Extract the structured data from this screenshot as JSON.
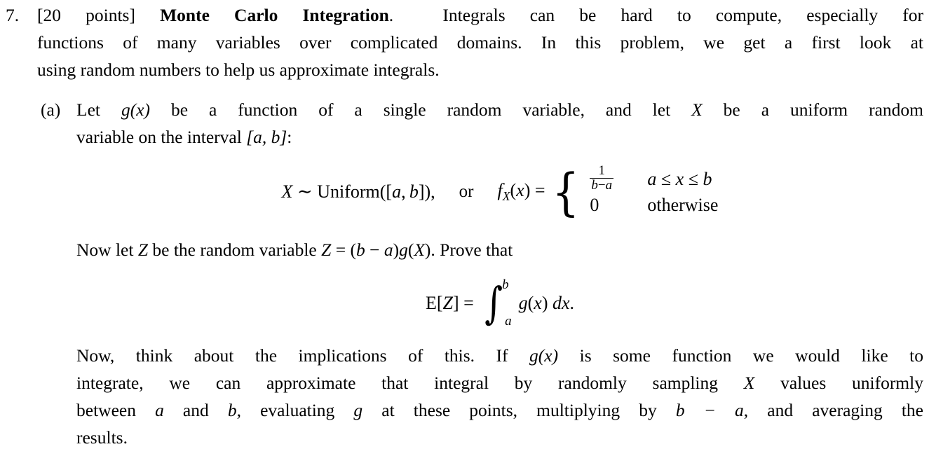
{
  "document": {
    "problem_number": "7.",
    "points_label": "[20 points]",
    "title": "Monte Carlo Integration",
    "title_period": ".",
    "intro": {
      "line1": "Integrals can be hard to compute, especially for",
      "line2": "functions of many variables over complicated domains. In this problem, we get a first look at",
      "line3": "using random numbers to help us approximate integrals."
    },
    "parts": [
      {
        "label": "(a)",
        "intro_line1_pre": "Let ",
        "intro_line1_g": "g(x)",
        "intro_line1_mid": " be a function of a single random variable, and let ",
        "intro_line1_X": "X",
        "intro_line1_post": " be a uniform random",
        "intro_line2_pre": "variable on the interval ",
        "intro_line2_interval": "[a, b]",
        "intro_line2_post": ":",
        "equation_uniform": {
          "lhs": "X ∼ Uniform([a, b]),",
          "or": "or",
          "fx": "f",
          "fx_sub": "X",
          "fx_arg": "(x) =",
          "case1_value_num": "1",
          "case1_value_den": "b−a",
          "case1_condition": "a ≤ x ≤ b",
          "case2_value": "0",
          "case2_condition": "otherwise"
        },
        "now_let": {
          "pre": "Now let ",
          "Z": "Z",
          "mid": " be the random variable ",
          "expr": "Z = (b − a)g(X)",
          "post": ". Prove that"
        },
        "equation_expectation": {
          "lhs": "E[Z] =",
          "integral_upper": "b",
          "integral_lower": "a",
          "integrand": "g(x) dx."
        },
        "closing": {
          "line1_pre": "Now, think about the implications of this. If ",
          "line1_g": "g(x)",
          "line1_post": " is some function we would like to",
          "line2_pre": "integrate, we can approximate that integral by randomly sampling ",
          "line2_X": "X",
          "line2_post": " values uniformly",
          "line3_pre": "between ",
          "line3_a": "a",
          "line3_mid1": " and ",
          "line3_b": "b",
          "line3_mid2": ", evaluating ",
          "line3_g": "g",
          "line3_mid3": " at these points, multiplying by ",
          "line3_bma": "b − a",
          "line3_post": ", and averaging the",
          "line4": "results."
        }
      }
    ]
  },
  "colors": {
    "background": "#ffffff",
    "text": "#000000"
  }
}
